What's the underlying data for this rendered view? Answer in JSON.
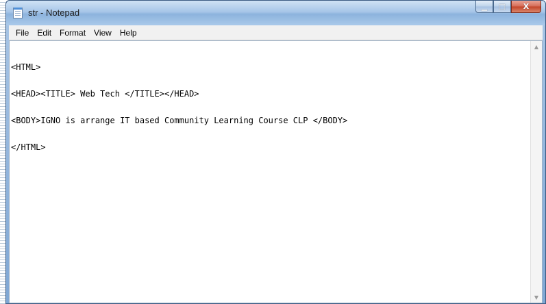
{
  "window": {
    "title": "str - Notepad"
  },
  "icons": {
    "app": "notepad-icon",
    "minimize": "minimize-icon",
    "maximize": "maximize-icon",
    "close": "close-icon"
  },
  "caption": {
    "minimize_glyph": "▁",
    "maximize_glyph": "□",
    "close_glyph": "X"
  },
  "menu": {
    "items": [
      "File",
      "Edit",
      "Format",
      "View",
      "Help"
    ]
  },
  "editor": {
    "lines": [
      "<HTML>",
      "<HEAD><TITLE> Web Tech </TITLE></HEAD>",
      "<BODY>IGNO is arrange IT based Community Learning Course CLP </BODY>",
      "</HTML>"
    ]
  },
  "scrollbar": {
    "up_glyph": "▲",
    "down_glyph": "▼"
  },
  "colors": {
    "titlebar": "#a7c6e8",
    "close_button": "#c34328",
    "menubar": "#f1f1f1",
    "editor_background": "#ffffff"
  }
}
